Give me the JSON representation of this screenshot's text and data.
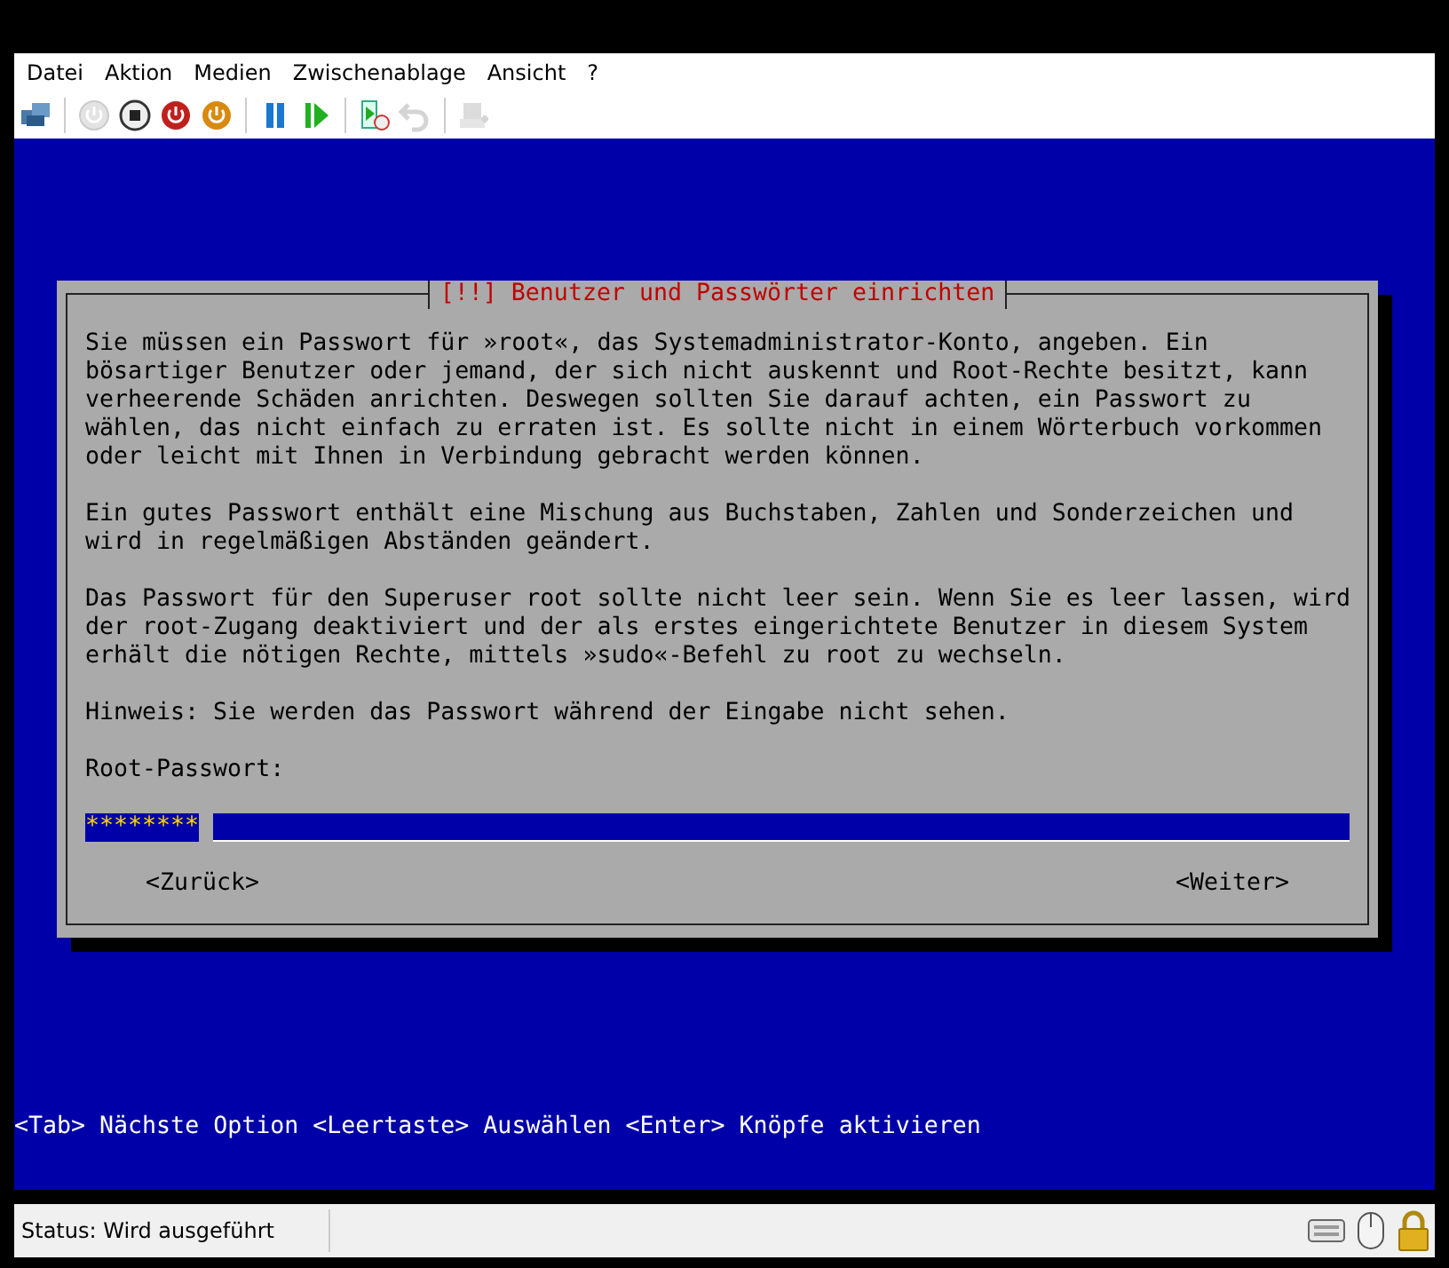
{
  "menu": [
    "Datei",
    "Aktion",
    "Medien",
    "Zwischenablage",
    "Ansicht",
    "?"
  ],
  "toolbar": [
    {
      "kind": "settings",
      "disabled": false
    },
    {
      "kind": "sep"
    },
    {
      "kind": "power",
      "disabled": true
    },
    {
      "kind": "stop",
      "disabled": false
    },
    {
      "kind": "shutdown",
      "disabled": false
    },
    {
      "kind": "save",
      "disabled": false
    },
    {
      "kind": "sep"
    },
    {
      "kind": "pause",
      "disabled": false
    },
    {
      "kind": "play",
      "disabled": false
    },
    {
      "kind": "sep"
    },
    {
      "kind": "snapshot",
      "disabled": false
    },
    {
      "kind": "revert",
      "disabled": true
    },
    {
      "kind": "sep"
    },
    {
      "kind": "share",
      "disabled": true
    }
  ],
  "dialog": {
    "title": "[!!] Benutzer und Passwörter einrichten",
    "paragraphs": [
      "Sie müssen ein Passwort für »root«, das Systemadministrator-Konto, angeben. Ein\nbösartiger Benutzer oder jemand, der sich nicht auskennt und Root-Rechte besitzt, kann\nverheerende Schäden anrichten. Deswegen sollten Sie darauf achten, ein Passwort zu\nwählen, das nicht einfach zu erraten ist. Es sollte nicht in einem Wörterbuch vorkommen\noder leicht mit Ihnen in Verbindung gebracht werden können.",
      "Ein gutes Passwort enthält eine Mischung aus Buchstaben, Zahlen und Sonderzeichen und\nwird in regelmäßigen Abständen geändert.",
      "Das Passwort für den Superuser root sollte nicht leer sein. Wenn Sie es leer lassen, wird\nder root-Zugang deaktiviert und der als erstes eingerichtete Benutzer in diesem System\nerhält die nötigen Rechte, mittels »sudo«-Befehl zu root zu wechseln.",
      "Hinweis: Sie werden das Passwort während der Eingabe nicht sehen."
    ],
    "field_label": "Root-Passwort:",
    "password": {
      "value": "********"
    },
    "buttons": [
      {
        "label": "<Zurück>",
        "selected": false
      },
      {
        "label": "<Weiter>",
        "selected": false
      }
    ]
  },
  "help_line": "<Tab> Nächste Option <Leertaste> Auswählen <Enter> Knöpfe aktivieren",
  "status_bar": {
    "text": "Status: Wird ausgeführt"
  }
}
